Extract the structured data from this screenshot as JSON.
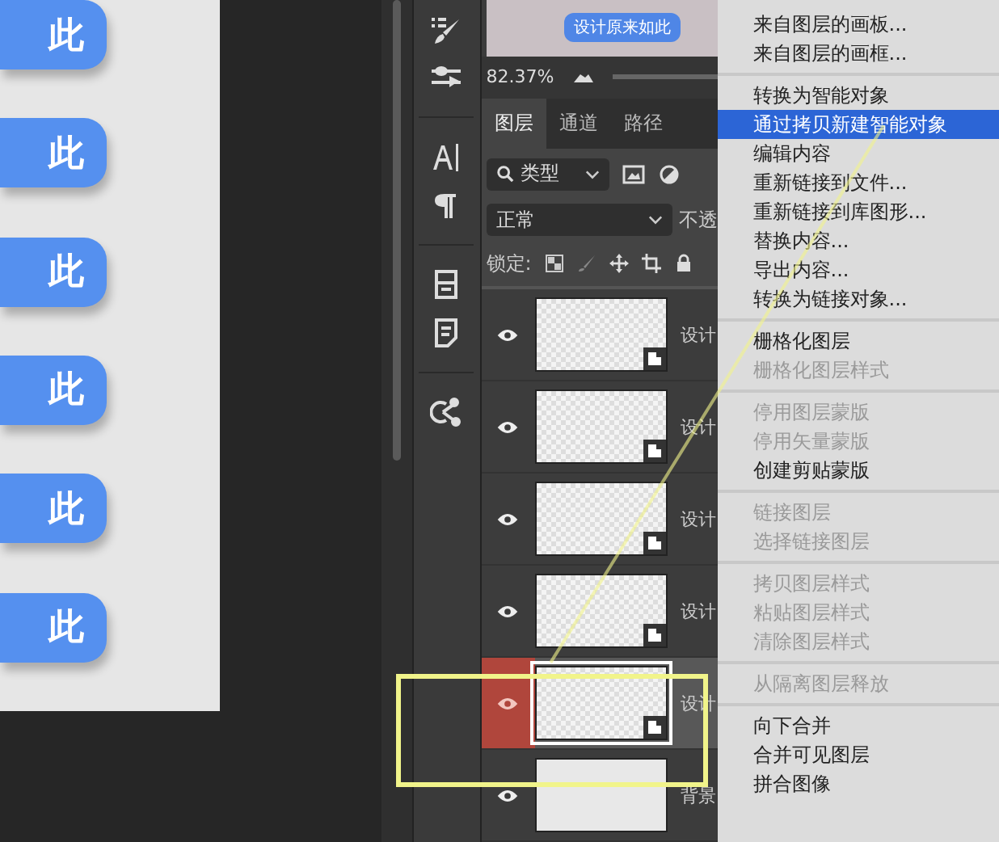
{
  "canvas": {
    "buttons": [
      {
        "label": "此"
      },
      {
        "label": "此"
      },
      {
        "label": "此"
      },
      {
        "label": "此"
      },
      {
        "label": "此"
      },
      {
        "label": "此"
      }
    ]
  },
  "preview": {
    "button_label": "设计原来如此"
  },
  "zoom": "82.37%",
  "tabs": [
    {
      "label": "图层",
      "selected": true
    },
    {
      "label": "通道",
      "selected": false
    },
    {
      "label": "路径",
      "selected": false
    }
  ],
  "filter": {
    "label": "类型"
  },
  "blend": {
    "value": "正常",
    "opacity_label": "不透"
  },
  "lock_label": "锁定:",
  "layers": [
    {
      "name": "设计",
      "kind": "smart",
      "visible": true,
      "selected": false
    },
    {
      "name": "设计",
      "kind": "smart",
      "visible": true,
      "selected": false
    },
    {
      "name": "设计",
      "kind": "smart",
      "visible": true,
      "selected": false
    },
    {
      "name": "设计",
      "kind": "smart",
      "visible": true,
      "selected": false
    },
    {
      "name": "设计",
      "kind": "smart",
      "visible": true,
      "selected": true
    },
    {
      "name": "背景",
      "kind": "background",
      "visible": true,
      "selected": false
    }
  ],
  "menu": [
    [
      {
        "label": "来自图层的画板...",
        "disabled": false,
        "selected": false
      },
      {
        "label": "来自图层的画框...",
        "disabled": false,
        "selected": false
      }
    ],
    [
      {
        "label": "转换为智能对象",
        "disabled": false,
        "selected": false
      },
      {
        "label": "通过拷贝新建智能对象",
        "disabled": false,
        "selected": true
      },
      {
        "label": "编辑内容",
        "disabled": false,
        "selected": false
      },
      {
        "label": "重新链接到文件...",
        "disabled": false,
        "selected": false
      },
      {
        "label": "重新链接到库图形...",
        "disabled": false,
        "selected": false
      },
      {
        "label": "替换内容...",
        "disabled": false,
        "selected": false
      },
      {
        "label": "导出内容...",
        "disabled": false,
        "selected": false
      },
      {
        "label": "转换为链接对象...",
        "disabled": false,
        "selected": false
      }
    ],
    [
      {
        "label": "栅格化图层",
        "disabled": false,
        "selected": false
      },
      {
        "label": "栅格化图层样式",
        "disabled": true,
        "selected": false
      }
    ],
    [
      {
        "label": "停用图层蒙版",
        "disabled": true,
        "selected": false
      },
      {
        "label": "停用矢量蒙版",
        "disabled": true,
        "selected": false
      },
      {
        "label": "创建剪贴蒙版",
        "disabled": false,
        "selected": false
      }
    ],
    [
      {
        "label": "链接图层",
        "disabled": true,
        "selected": false
      },
      {
        "label": "选择链接图层",
        "disabled": true,
        "selected": false
      }
    ],
    [
      {
        "label": "拷贝图层样式",
        "disabled": true,
        "selected": false
      },
      {
        "label": "粘贴图层样式",
        "disabled": true,
        "selected": false
      },
      {
        "label": "清除图层样式",
        "disabled": true,
        "selected": false
      }
    ],
    [
      {
        "label": "从隔离图层释放",
        "disabled": true,
        "selected": false
      }
    ],
    [
      {
        "label": "向下合并",
        "disabled": false,
        "selected": false
      },
      {
        "label": "合并可见图层",
        "disabled": false,
        "selected": false
      },
      {
        "label": "拼合图像",
        "disabled": false,
        "selected": false
      }
    ]
  ]
}
